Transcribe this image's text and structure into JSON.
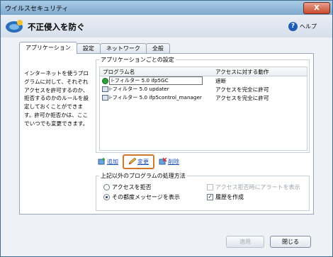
{
  "window": {
    "title": "ウイルスセキュリティ",
    "close_label": "X"
  },
  "header": {
    "title": "不正侵入を防ぐ",
    "help_label": "ヘルプ"
  },
  "tabs": [
    {
      "label": "アプリケーション"
    },
    {
      "label": "設定"
    },
    {
      "label": "ネットワーク"
    },
    {
      "label": "全般"
    }
  ],
  "description": "インターネットを使うプログラムに対して、それぞれアクセスを許可するのか、拒否するのかのルールを設定しておくことができます。許可か拒否かは、ここでいつでも変更できます。",
  "app_settings": {
    "legend": "アプリケーションごとの設定",
    "col_program": "プログラム名",
    "col_action": "アクセスに対する動作",
    "rows": [
      {
        "name": "i-フィルター 5.0 ifp5GC",
        "action": "遮断",
        "icon": "green-shield-icon"
      },
      {
        "name": "i-フィルター 5.0 updater",
        "action": "アクセスを完全に許可",
        "icon": "window-icon"
      },
      {
        "name": "i-フィルター 5.0 ifp5control_manager",
        "action": "アクセスを完全に許可",
        "icon": "window-icon"
      }
    ]
  },
  "actions": {
    "add": "追加",
    "change": "変更",
    "delete": "削除"
  },
  "other_programs": {
    "legend": "上記以外のプログラムの処理方法",
    "radio_block": "アクセスを拒否",
    "radio_ask": "その都度メッセージを表示",
    "check_alert": "アクセス拒否時にアラートを表示",
    "check_history": "履歴を作成"
  },
  "footer": {
    "apply": "適用",
    "close": "閉じる"
  }
}
